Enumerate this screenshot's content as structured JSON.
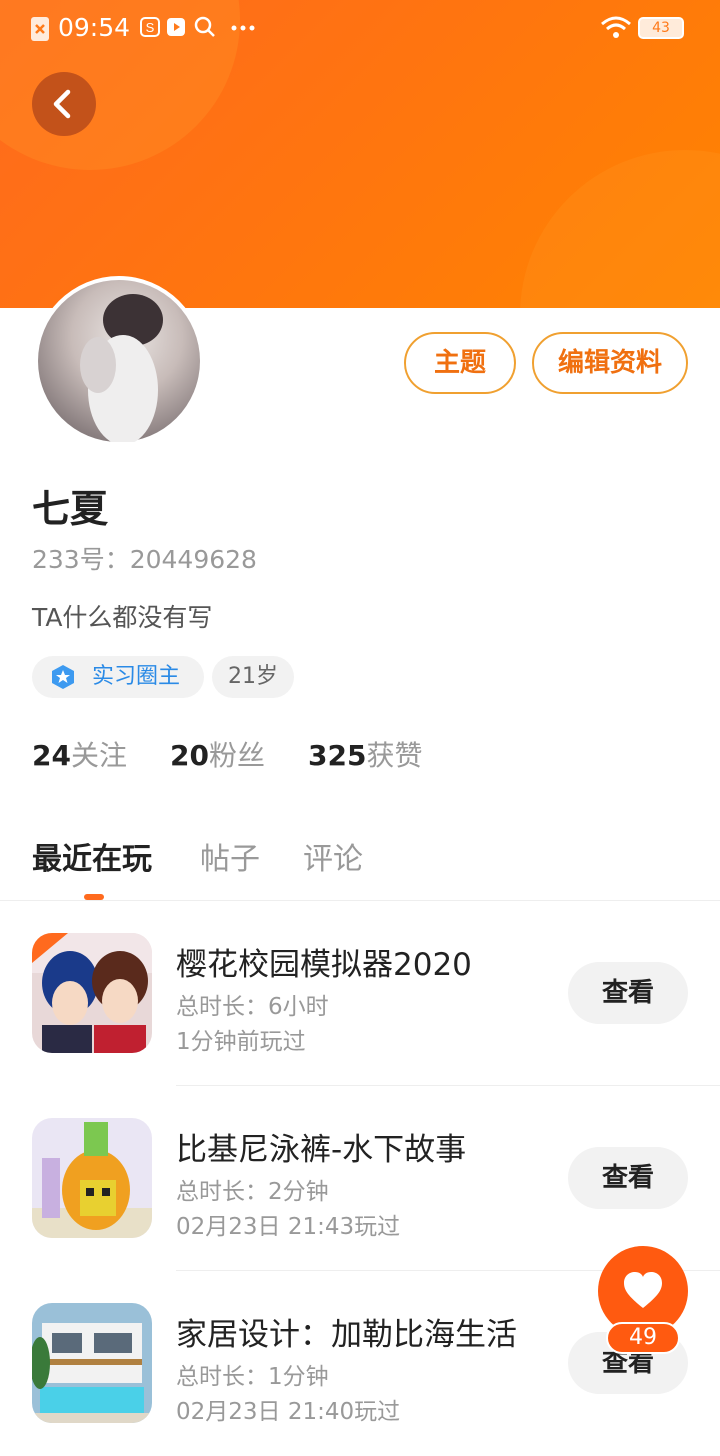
{
  "status_bar": {
    "time": "09:54",
    "battery": "43"
  },
  "profile": {
    "name": "七夏",
    "uid": "233号：20449628",
    "bio": "TA什么都没有写",
    "tags": [
      {
        "label": "实习圈主"
      },
      {
        "label": "21岁"
      }
    ],
    "stats": [
      {
        "value": "24",
        "label": "关注"
      },
      {
        "value": "20",
        "label": "粉丝"
      },
      {
        "value": "325",
        "label": "获赞"
      }
    ]
  },
  "actions": {
    "theme_label": "主题",
    "edit_label": "编辑资料"
  },
  "tabs": [
    {
      "label": "最近在玩"
    },
    {
      "label": "帖子"
    },
    {
      "label": "评论"
    }
  ],
  "games": [
    {
      "title": "樱花校园模拟器2020",
      "duration": "总时长：6小时",
      "last_played": "1分钟前玩过",
      "view_label": "查看"
    },
    {
      "title": "比基尼泳裤-水下故事",
      "duration": "总时长：2分钟",
      "last_played": "02月23日 21:43玩过",
      "view_label": "查看"
    },
    {
      "title": "家居设计：加勒比海生活",
      "duration": "总时长：1分钟",
      "last_played": "02月23日 21:40玩过",
      "view_label": "查看"
    }
  ],
  "like": {
    "count": "49"
  },
  "colors": {
    "accent": "#ff6a1e",
    "badge_blue": "#2a8ae6"
  },
  "icons": [
    "back-arrow-icon",
    "wifi-icon",
    "battery-icon",
    "search-icon",
    "more-icon",
    "heart-icon",
    "star-badge-icon"
  ]
}
